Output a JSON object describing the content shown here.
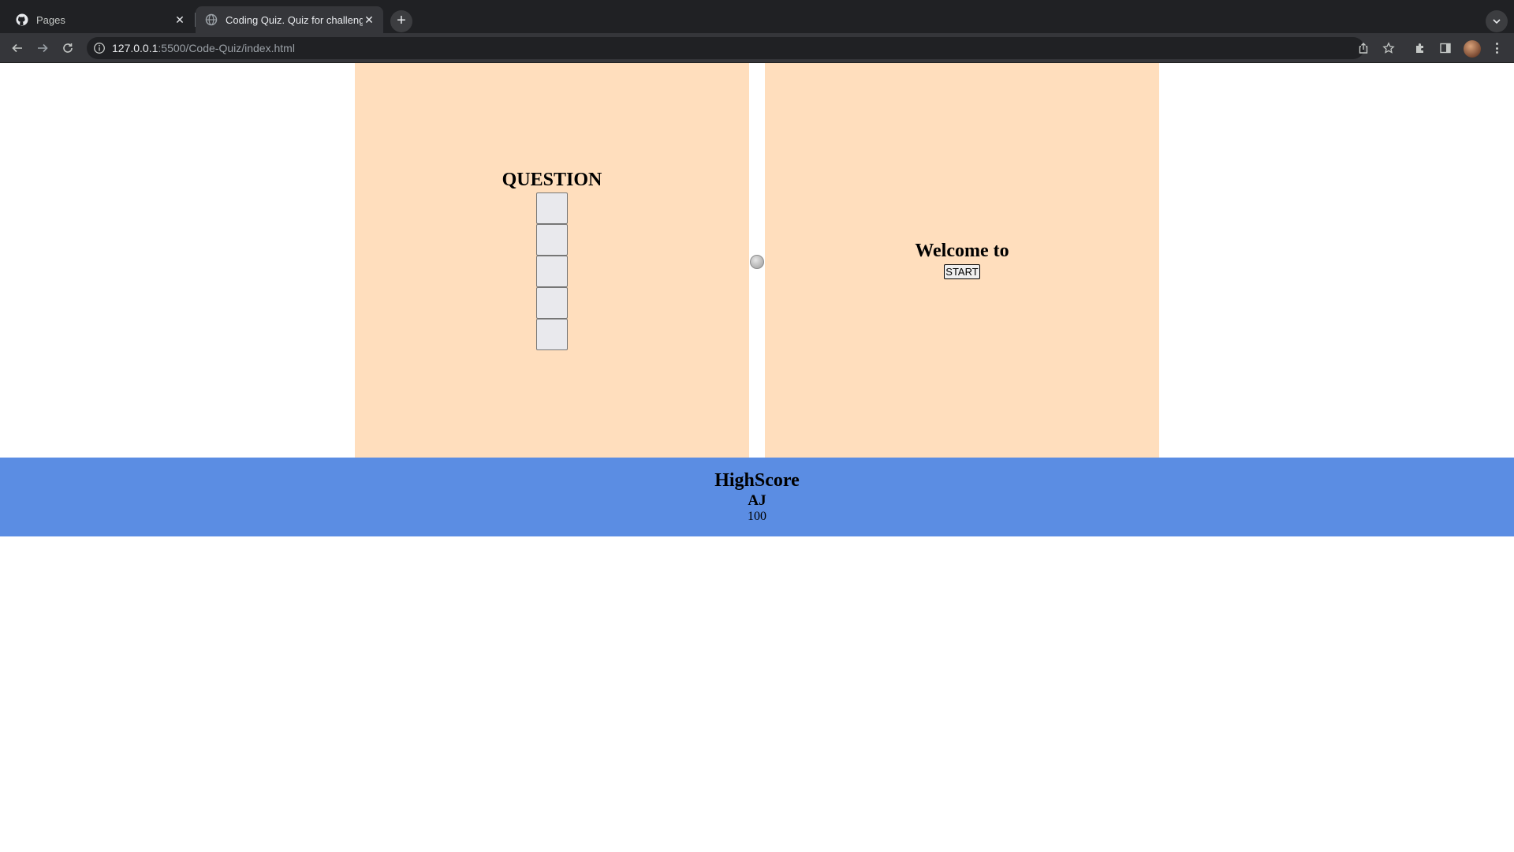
{
  "browser": {
    "tabs": [
      {
        "title": "Pages",
        "icon": "github-icon",
        "active": false
      },
      {
        "title": "Coding Quiz. Quiz for challenge",
        "icon": "globe-icon",
        "active": true
      }
    ],
    "url": {
      "host": "127.0.0.1",
      "rest": ":5500/Code-Quiz/index.html"
    }
  },
  "quiz": {
    "question_title": "QUESTION",
    "answers": [
      "",
      "",
      "",
      "",
      ""
    ]
  },
  "welcome": {
    "title": "Welcome to",
    "start_label": "START"
  },
  "highscore": {
    "title": "HighScore",
    "name": "AJ",
    "score": "100"
  },
  "colors": {
    "panel_bg": "#ffdebd",
    "highscore_bg": "#5b8de3",
    "chrome_dark": "#202124",
    "chrome_toolbar": "#35363a"
  }
}
